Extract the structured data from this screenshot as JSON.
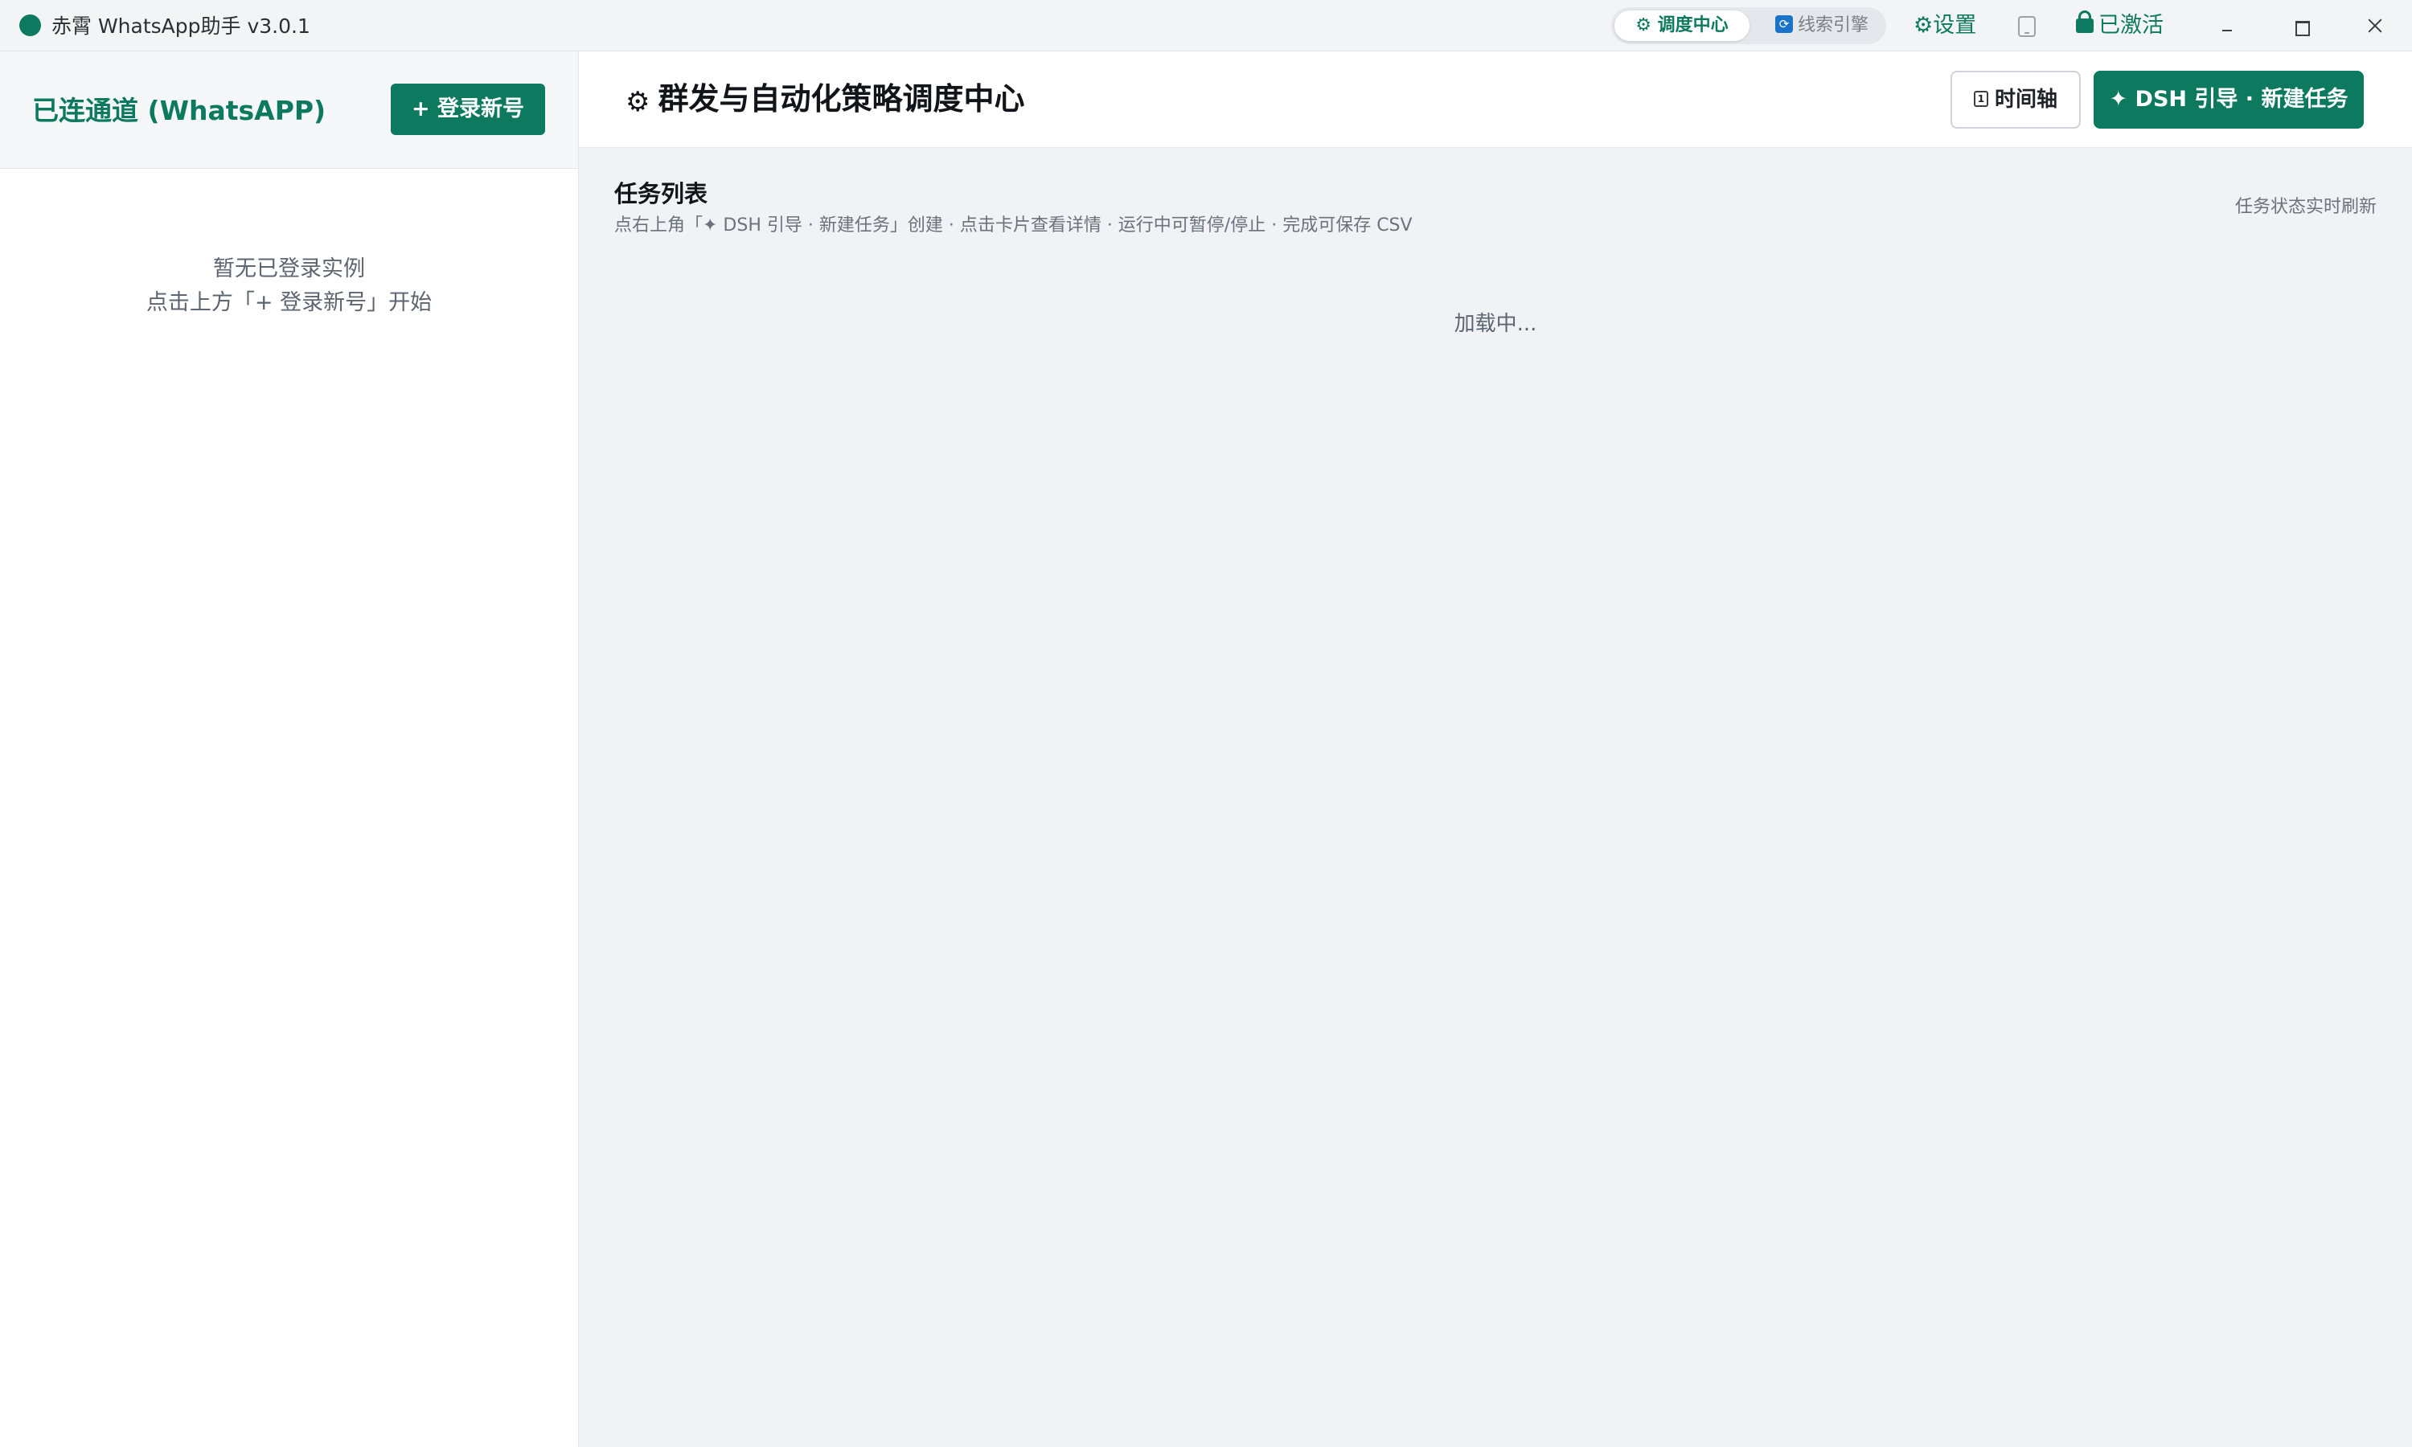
{
  "titlebar": {
    "app_title": "赤霄 WhatsApp助手 v3.0.1",
    "tabs": [
      {
        "label": "⚙ 调度中心",
        "active": true
      },
      {
        "label": "线索引擎",
        "active": false
      }
    ],
    "settings_label": "⚙设置",
    "activated_label": "已激活"
  },
  "sidebar": {
    "title": "已连通道 (WhatsAPP)",
    "login_button": "+ 登录新号",
    "empty_line1": "暂无已登录实例",
    "empty_line2": "点击上方「+ 登录新号」开始"
  },
  "main": {
    "title": "群发与自动化策略调度中心",
    "timeline_button": "时间轴",
    "new_task_button": "✦ DSH 引导 · 新建任务",
    "section_title": "任务列表",
    "section_subtitle": "点右上角「✦ DSH 引导 · 新建任务」创建 · 点击卡片查看详情 · 运行中可暂停/停止 · 完成可保存 CSV",
    "refresh_note": "任务状态实时刷新",
    "loading_text": "加载中..."
  },
  "colors": {
    "brand": "#0d7a5f",
    "background": "#f0f2f5"
  }
}
